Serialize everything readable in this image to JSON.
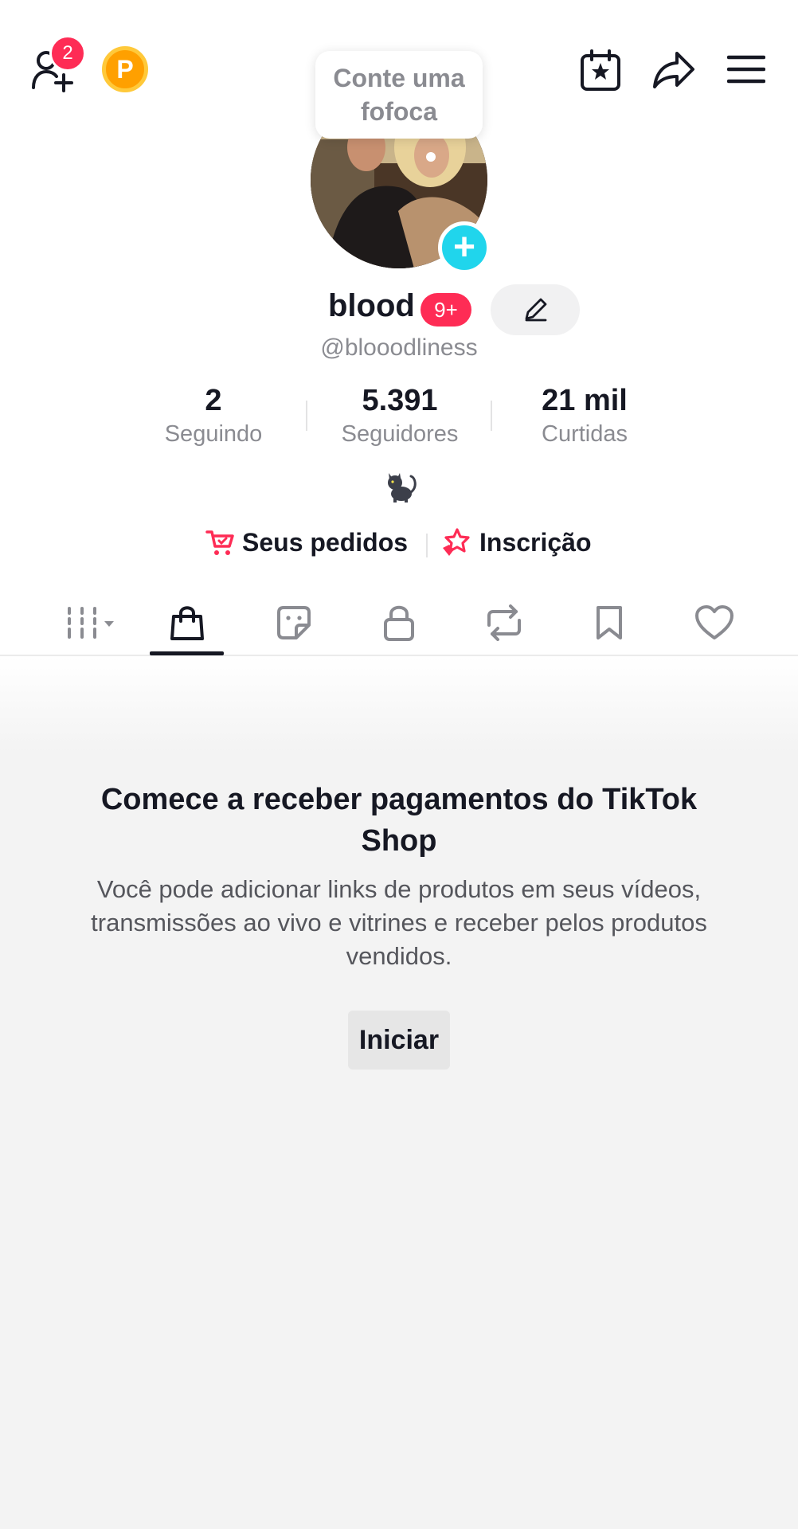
{
  "header": {
    "friends_badge": "2",
    "coin_label": "P"
  },
  "profile": {
    "bubble_text": "Conte uma fofoca",
    "display_name": "blood",
    "name_badge": "9+",
    "handle": "@blooodliness",
    "bio_icon": "black-cat-emoji"
  },
  "stats": [
    {
      "value": "2",
      "label": "Seguindo"
    },
    {
      "value": "5.391",
      "label": "Seguidores"
    },
    {
      "value": "21 mil",
      "label": "Curtidas"
    }
  ],
  "links": {
    "orders": "Seus pedidos",
    "subscription": "Inscrição"
  },
  "tabs": [
    "videos-grid",
    "shop",
    "stickers",
    "private",
    "reposts",
    "favorites",
    "liked"
  ],
  "active_tab": "shop",
  "shop": {
    "title": "Comece a receber pagamentos do TikTok Shop",
    "description": "Você pode adicionar links de produtos em seus vídeos, transmissões ao vivo e vitrines e receber pelos produtos vendidos.",
    "button": "Iniciar"
  },
  "colors": {
    "accent_red": "#fe2c55",
    "accent_cyan": "#20d5ec",
    "coin": "#ffa000"
  }
}
